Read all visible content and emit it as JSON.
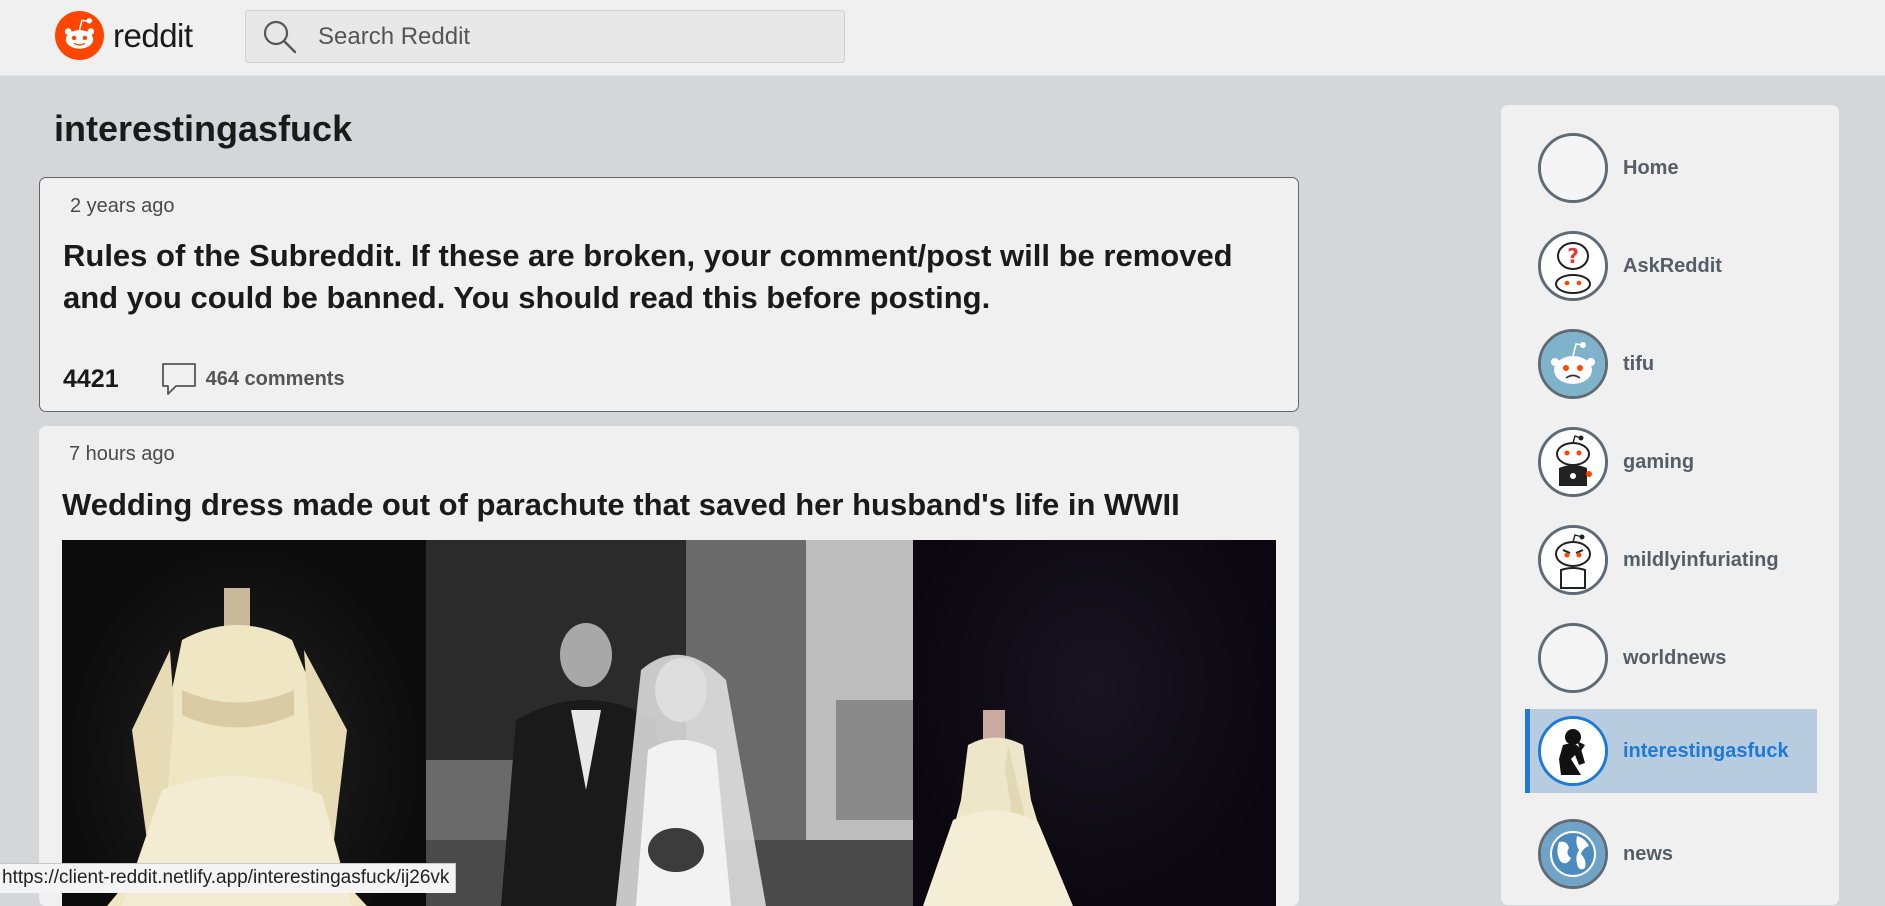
{
  "header": {
    "logo_text": "reddit",
    "search_placeholder": "Search Reddit"
  },
  "main": {
    "subreddit": "interestingasfuck",
    "posts": [
      {
        "time": "2 years ago",
        "title": "Rules of the Subreddit. If these are broken, your comment/post will be removed and you could be banned. You should read this before posting.",
        "votes": "4421",
        "comments": "464 comments"
      },
      {
        "time": "7 hours ago",
        "title": "Wedding dress made out of parachute that saved her husband's life in WWII"
      }
    ]
  },
  "sidebar": {
    "items": [
      {
        "label": "Home",
        "icon": "empty-circle-icon"
      },
      {
        "label": "AskReddit",
        "icon": "askreddit-icon"
      },
      {
        "label": "tifu",
        "icon": "tifu-icon"
      },
      {
        "label": "gaming",
        "icon": "gaming-icon"
      },
      {
        "label": "mildlyinfuriating",
        "icon": "mildlyinfuriating-icon"
      },
      {
        "label": "worldnews",
        "icon": "empty-circle-icon"
      },
      {
        "label": "interestingasfuck",
        "icon": "thinker-icon",
        "active": true
      },
      {
        "label": "news",
        "icon": "globe-icon"
      }
    ]
  },
  "status_bar": {
    "url": "https://client-reddit.netlify.app/interestingasfuck/ij26vk"
  },
  "colors": {
    "brand": "#ff4500",
    "accent": "#1d7ad6",
    "active_bg": "#b8ccdf",
    "page_bg": "#d4d6da",
    "card_bg": "#f0f0f0"
  }
}
